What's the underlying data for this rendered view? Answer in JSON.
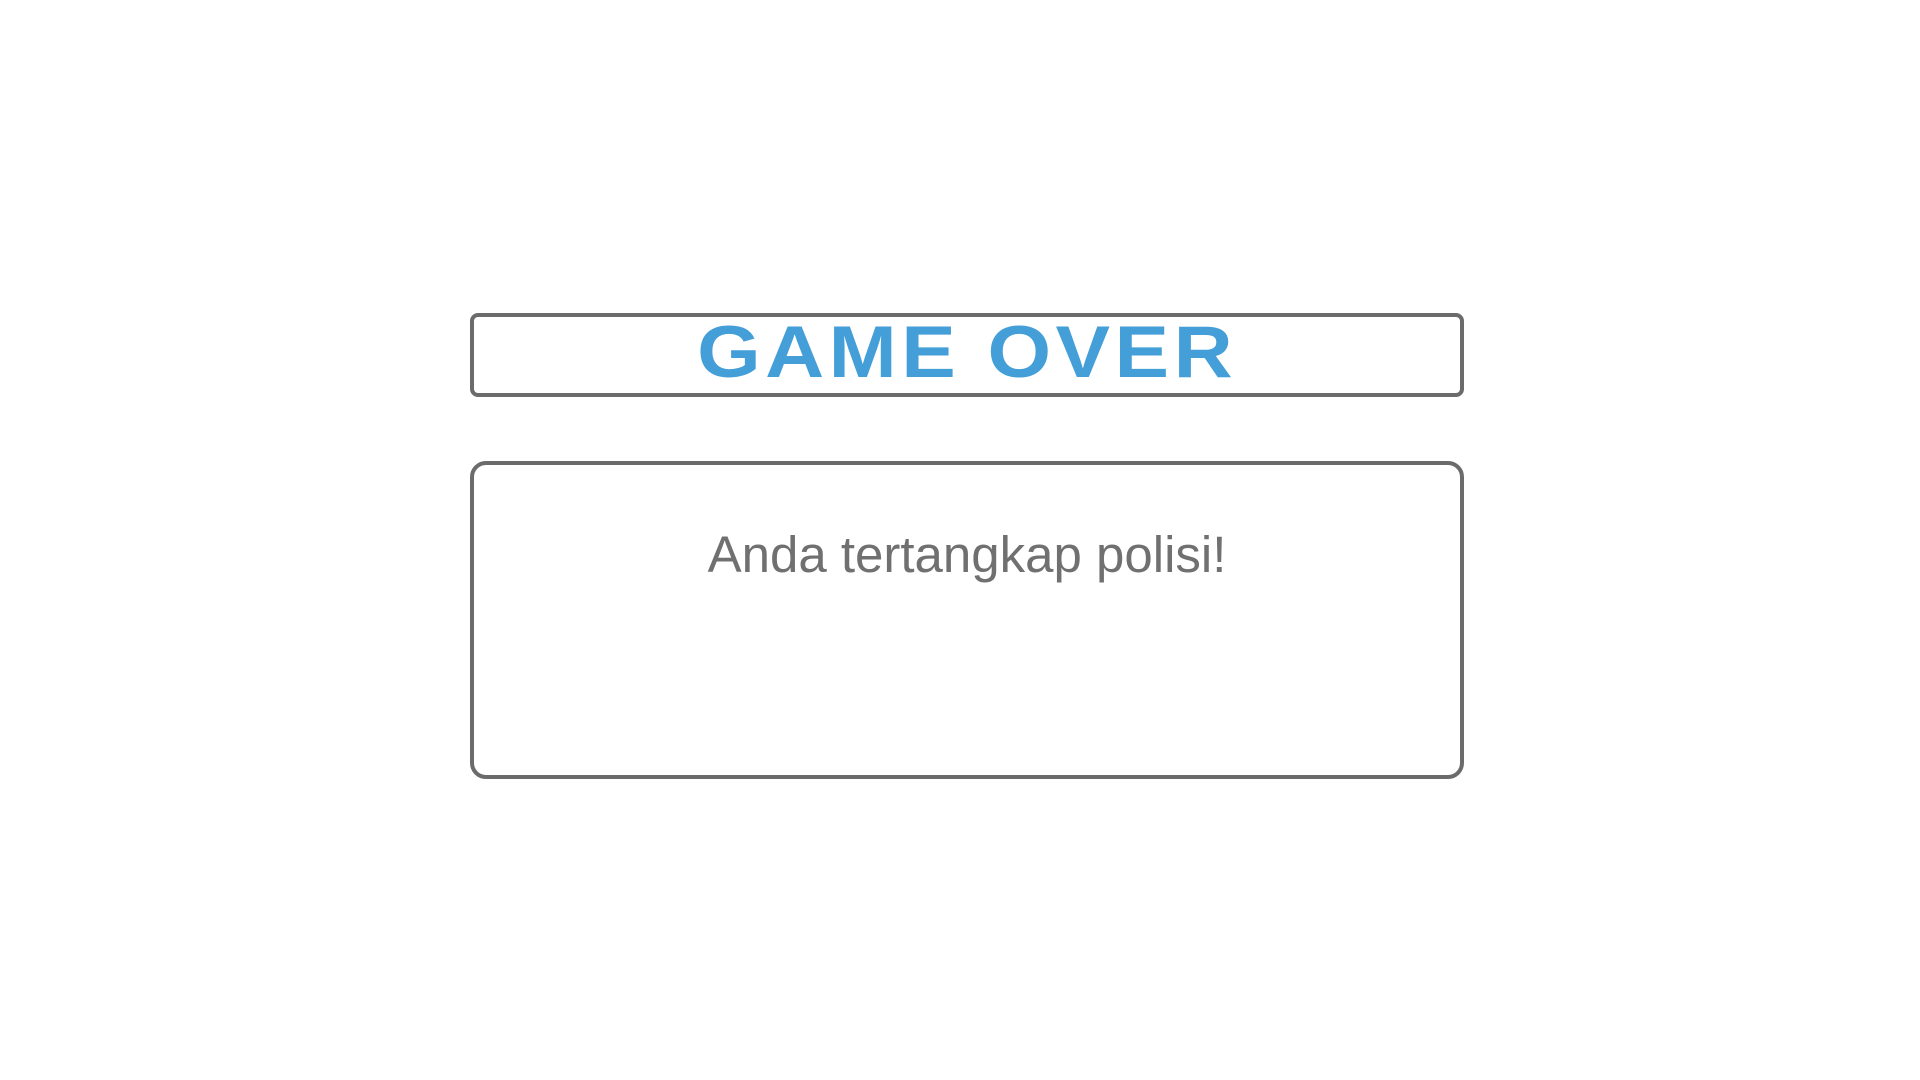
{
  "game_over": {
    "title": "GAME OVER",
    "message": "Anda tertangkap polisi!"
  },
  "colors": {
    "title": "#449ed8",
    "message": "#707070",
    "border": "#6b6b6b",
    "background": "#ffffff"
  }
}
